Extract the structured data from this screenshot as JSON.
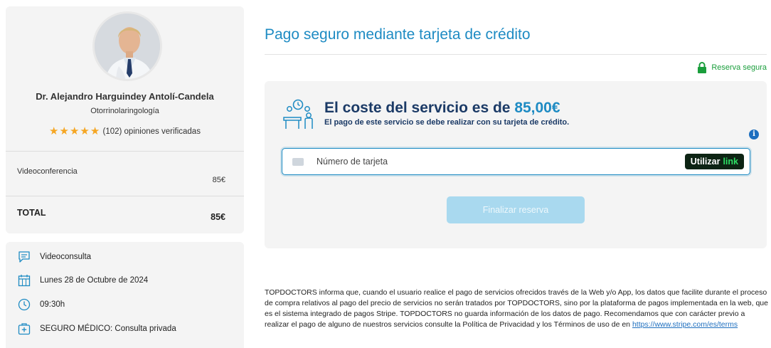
{
  "doctor": {
    "name": "Dr. Alejandro Harguindey Antolí-Candela",
    "specialty": "Otorrinolaringología",
    "stars": "★★★★★",
    "reviews": "(102) opiniones verificadas"
  },
  "service": {
    "name": "Videoconferencia",
    "price": "85€",
    "total_label": "TOTAL",
    "total_price": "85€"
  },
  "appointment": {
    "type": "Videoconsulta",
    "date": "Lunes 28 de Octubre de 2024",
    "time": "09:30h",
    "insurance": "SEGURO MÉDICO: Consulta privada"
  },
  "payment": {
    "title": "Pago seguro mediante tarjeta de crédito",
    "secure_label": "Reserva segura",
    "cost_prefix": "El coste del servicio es de ",
    "cost_amount": "85,00€",
    "cost_subtitle": "El pago de este servicio se debe realizar con su tarjeta de crédito.",
    "card_placeholder": "Número de tarjeta",
    "link_button": "Utilizar",
    "link_brand": "link",
    "finalize_button": "Finalizar reserva"
  },
  "legal": {
    "text": "TOPDOCTORS informa que, cuando el usuario realice el pago de servicios ofrecidos través de la Web y/o App, los datos que facilite durante el proceso de compra relativos al pago del precio de servicios no serán tratados por TOPDOCTORS, sino por la plataforma de pagos implementada en la web, que es el sistema integrado de pagos Stripe. TOPDOCTORS no guarda información de los datos de pago. Recomendamos que con carácter previo a realizar el pago de alguno de nuestros servicios consulte la Política de Privacidad y los Términos de uso de en ",
    "link": "https://www.stripe.com/es/terms"
  },
  "colors": {
    "brand_blue": "#1e8bc3",
    "navy": "#1b3a66",
    "secure_green": "#1a9e3c",
    "star_gold": "#f5a623"
  },
  "icons": [
    "doctor-avatar",
    "chat-icon",
    "calendar-icon",
    "clock-icon",
    "medical-case-icon",
    "lock-icon",
    "payment-desk-icon",
    "info-icon",
    "card-icon"
  ]
}
